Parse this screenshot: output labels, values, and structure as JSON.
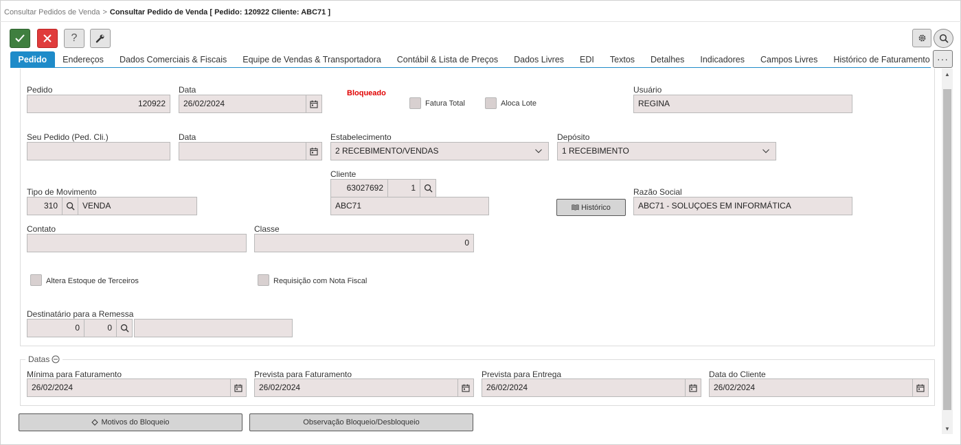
{
  "breadcrumb": {
    "parent": "Consultar Pedidos de Venda",
    "separator": ">",
    "current": "Consultar Pedido de Venda [ Pedido: 120922 Cliente: ABC71 ]"
  },
  "toolbar": {
    "help_label": "?",
    "more_label": "···"
  },
  "tabs": [
    {
      "label": "Pedido",
      "active": true
    },
    {
      "label": "Endereços"
    },
    {
      "label": "Dados Comerciais & Fiscais"
    },
    {
      "label": "Equipe de Vendas & Transportadora"
    },
    {
      "label": "Contábil & Lista de Preços"
    },
    {
      "label": "Dados Livres"
    },
    {
      "label": "EDI"
    },
    {
      "label": "Textos"
    },
    {
      "label": "Detalhes"
    },
    {
      "label": "Indicadores"
    },
    {
      "label": "Campos Livres"
    },
    {
      "label": "Histórico de Faturamento"
    }
  ],
  "form": {
    "pedido_label": "Pedido",
    "pedido_value": "120922",
    "data_label": "Data",
    "data_value": "26/02/2024",
    "status_text": "Bloqueado",
    "fatura_total_label": "Fatura Total",
    "aloca_lote_label": "Aloca Lote",
    "usuario_label": "Usuário",
    "usuario_value": "REGINA",
    "seu_pedido_label": "Seu Pedido (Ped. Cli.)",
    "seu_pedido_value": "",
    "data2_label": "Data",
    "data2_value": "",
    "estabelecimento_label": "Estabelecimento",
    "estabelecimento_value": "2 RECEBIMENTO/VENDAS",
    "deposito_label": "Depósito",
    "deposito_value": "1 RECEBIMENTO",
    "cliente_label": "Cliente",
    "cliente_code": "63027692",
    "cliente_seq": "1",
    "cliente_name": "ABC71",
    "tipo_mov_label": "Tipo de Movimento",
    "tipo_mov_code": "310",
    "tipo_mov_desc": "VENDA",
    "historico_label": "Histórico",
    "razao_social_label": "Razão Social",
    "razao_social_value": "ABC71 - SOLUÇOES EM INFORMÁTICA",
    "contato_label": "Contato",
    "contato_value": "",
    "classe_label": "Classe",
    "classe_value": "0",
    "altera_estoque_label": "Altera Estoque de Terceiros",
    "requisicao_label": "Requisição com Nota Fiscal",
    "destinatario_label": "Destinatário para a Remessa",
    "destinatario_a": "0",
    "destinatario_b": "0",
    "destinatario_desc": ""
  },
  "datas": {
    "legend": "Datas",
    "minima_label": "Mínima para Faturamento",
    "minima_value": "26/02/2024",
    "prev_fat_label": "Prevista para Faturamento",
    "prev_fat_value": "26/02/2024",
    "prev_ent_label": "Prevista para Entrega",
    "prev_ent_value": "26/02/2024",
    "cliente_label": "Data do Cliente",
    "cliente_value": "26/02/2024"
  },
  "buttons": {
    "motivos_label": "Motivos do Bloqueio",
    "observacao_label": "Observação Bloqueio/Desbloqueio"
  },
  "colors": {
    "accent": "#1e8bc9",
    "ok": "#3f7f3f",
    "cancel": "#e03c3c",
    "field_bg": "#eae2e2",
    "status_red": "#e00000"
  },
  "icons": [
    "check-icon",
    "close-icon",
    "wrench-icon",
    "gear-icon",
    "search-icon",
    "calendar-icon",
    "chevron-down-icon",
    "book-icon",
    "minus-circle-icon",
    "diamond-icon"
  ]
}
